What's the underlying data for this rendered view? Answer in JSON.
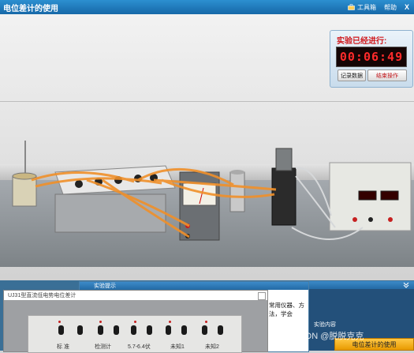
{
  "window": {
    "title": "电位差计的使用",
    "toolbox_label": "工具箱",
    "help_label": "帮助",
    "close_label": "X"
  },
  "timer": {
    "label": "实验已经进行:",
    "time": "00:06:49",
    "record_label": "记录数据",
    "end_label": "结束操作"
  },
  "hint": {
    "header": "实验提示",
    "text": "常用仪器、方法，学会"
  },
  "image_window": {
    "caption": "UJ31型直流低电势电位差计",
    "labels": [
      "标 准",
      "检测计",
      "5.7-6.4伏",
      "未知1",
      "未知2"
    ]
  },
  "content_panel": {
    "title": "实验内容",
    "task_label": "电位差计的使用"
  },
  "watermark": "CSDN @脱脱克克",
  "colors": {
    "titlebar": "#1e77bd",
    "timer_digits": "#ff2b2b",
    "wire": "#f0902a",
    "task_button": "#f5b123"
  },
  "icons": {
    "toolbox": "toolbox-icon",
    "expand": "expand-arrows-icon"
  }
}
